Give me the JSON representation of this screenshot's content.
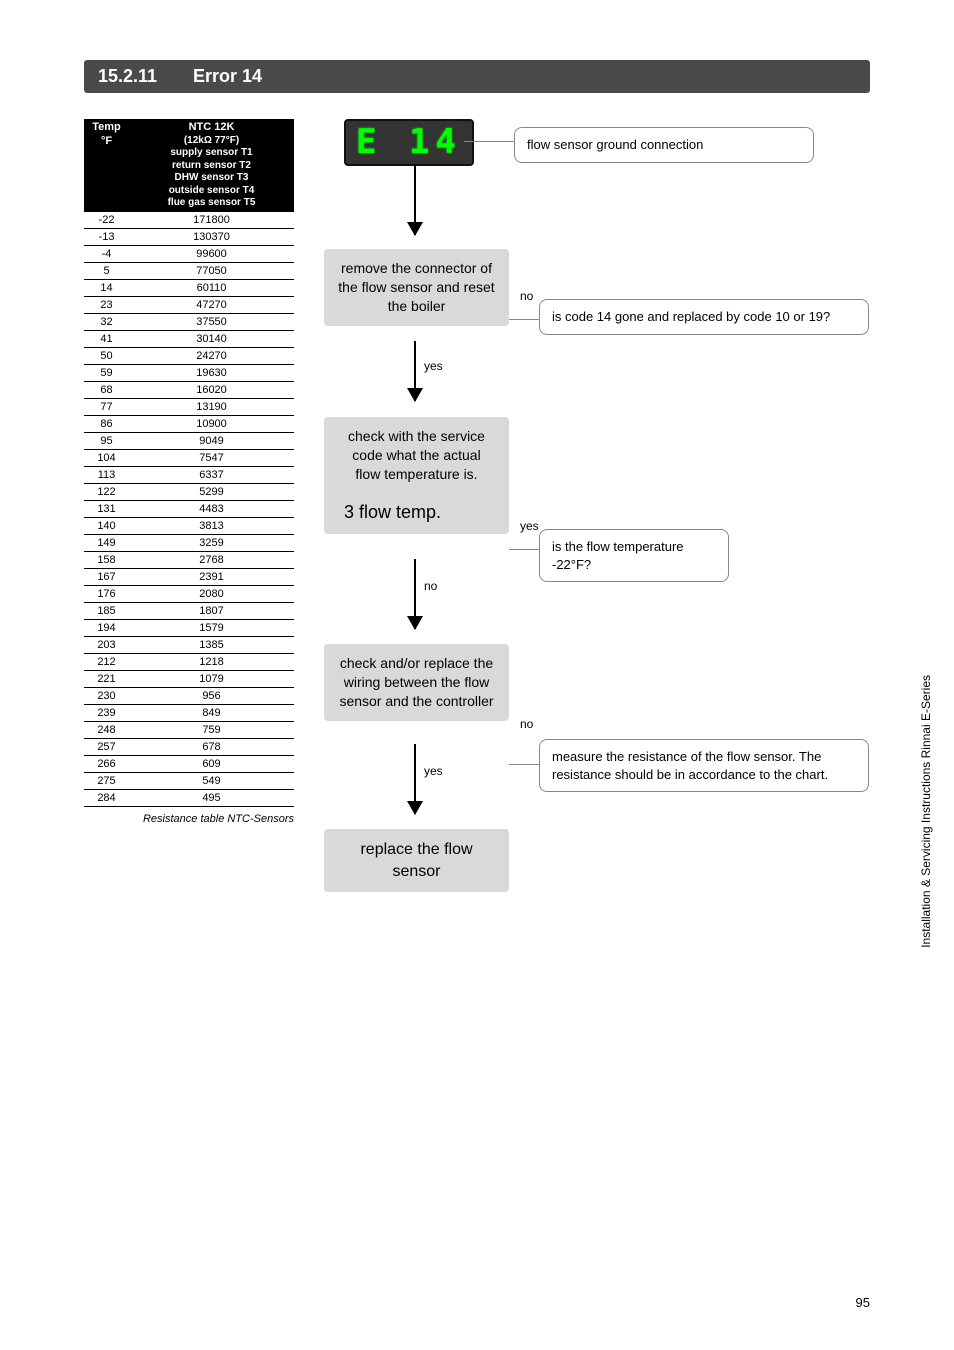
{
  "header": {
    "number": "15.2.11",
    "title": "Error 14"
  },
  "table": {
    "col1_header": "Temp\n°F",
    "col2_header_top": "NTC 12K",
    "col2_header_lines": [
      "(12kΩ  77°F)",
      "supply sensor  T1",
      "return sensor T2",
      "DHW sensor   T3",
      "outside sensor  T4",
      "flue gas sensor  T5"
    ],
    "rows": [
      [
        "-22",
        "171800"
      ],
      [
        "-13",
        "130370"
      ],
      [
        "-4",
        "99600"
      ],
      [
        "5",
        "77050"
      ],
      [
        "14",
        "60110"
      ],
      [
        "23",
        "47270"
      ],
      [
        "32",
        "37550"
      ],
      [
        "41",
        "30140"
      ],
      [
        "50",
        "24270"
      ],
      [
        "59",
        "19630"
      ],
      [
        "68",
        "16020"
      ],
      [
        "77",
        "13190"
      ],
      [
        "86",
        "10900"
      ],
      [
        "95",
        "9049"
      ],
      [
        "104",
        "7547"
      ],
      [
        "113",
        "6337"
      ],
      [
        "122",
        "5299"
      ],
      [
        "131",
        "4483"
      ],
      [
        "140",
        "3813"
      ],
      [
        "149",
        "3259"
      ],
      [
        "158",
        "2768"
      ],
      [
        "167",
        "2391"
      ],
      [
        "176",
        "2080"
      ],
      [
        "185",
        "1807"
      ],
      [
        "194",
        "1579"
      ],
      [
        "203",
        "1385"
      ],
      [
        "212",
        "1218"
      ],
      [
        "221",
        "1079"
      ],
      [
        "230",
        "956"
      ],
      [
        "239",
        "849"
      ],
      [
        "248",
        "759"
      ],
      [
        "257",
        "678"
      ],
      [
        "266",
        "609"
      ],
      [
        "275",
        "549"
      ],
      [
        "284",
        "495"
      ]
    ],
    "caption": "Resistance table NTC-Sensors"
  },
  "flow": {
    "display": "E 14",
    "callout0": "flow sensor ground connection",
    "box1": "remove the connector of the flow sensor and reset the boiler",
    "callout1": "is code 14 gone and replaced by code 10 or 19?",
    "box2_line1": "check with the service code what the actual flow temperature is.",
    "box2_line2": "3  flow temp.",
    "callout2": "is the flow temperature -22°F?",
    "box3": "check and/or replace the wiring between the flow sensor and the controller",
    "callout3": "measure the resistance of the flow sensor. The resistance should be in accordance to the chart.",
    "box4": "replace the flow sensor",
    "yes": "yes",
    "no": "no"
  },
  "footer": {
    "side": "Installation & Servicing Instructions Rinnai E-Series",
    "page": "95"
  }
}
